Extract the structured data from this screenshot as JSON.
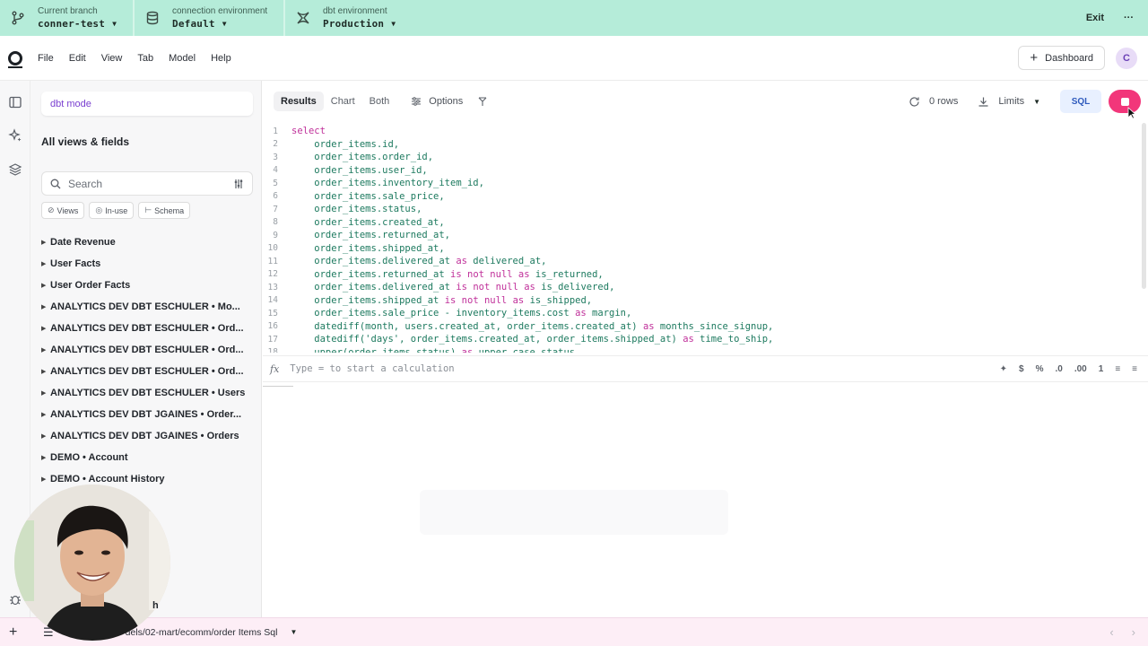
{
  "env_bar": {
    "branch": {
      "caption": "Current branch",
      "value": "conner-test"
    },
    "connection": {
      "caption": "connection environment",
      "value": "Default"
    },
    "dbt_env": {
      "caption": "dbt environment",
      "value": "Production"
    },
    "exit_label": "Exit",
    "more_label": "···"
  },
  "menu": {
    "items": [
      "File",
      "Edit",
      "View",
      "Tab",
      "Model",
      "Help"
    ],
    "dashboard_label": "Dashboard",
    "avatar_initial": "C"
  },
  "sidebar": {
    "mode_label": "dbt mode",
    "title": "All views & fields",
    "search_placeholder": "Search",
    "filters": [
      "Views",
      "In-use",
      "Schema"
    ],
    "items": [
      "Date Revenue",
      "User Facts",
      "User Order Facts",
      "ANALYTICS DEV DBT ESCHULER • Mo...",
      "ANALYTICS DEV DBT ESCHULER • Ord...",
      "ANALYTICS DEV DBT ESCHULER • Ord...",
      "ANALYTICS DEV DBT ESCHULER • Ord...",
      "ANALYTICS DEV DBT ESCHULER • Users",
      "ANALYTICS DEV DBT JGAINES • Order...",
      "ANALYTICS DEV DBT JGAINES • Orders",
      "DEMO • Account",
      "DEMO • Account History"
    ],
    "partial_item": "h"
  },
  "toolbar": {
    "tabs": [
      "Results",
      "Chart",
      "Both"
    ],
    "options_label": "Options",
    "rows_label": "0 rows",
    "limits_label": "Limits",
    "sql_label": "SQL"
  },
  "editor": {
    "lines": [
      {
        "n": "1",
        "kw": "select",
        "rest": ""
      },
      {
        "n": "2",
        "kw": "",
        "rest": "    order_items.id,"
      },
      {
        "n": "3",
        "kw": "",
        "rest": "    order_items.order_id,"
      },
      {
        "n": "4",
        "kw": "",
        "rest": "    order_items.user_id,"
      },
      {
        "n": "5",
        "kw": "",
        "rest": "    order_items.inventory_item_id,"
      },
      {
        "n": "6",
        "kw": "",
        "rest": "    order_items.sale_price,"
      },
      {
        "n": "7",
        "kw": "",
        "rest": "    order_items.status,"
      },
      {
        "n": "8",
        "kw": "",
        "rest": "    order_items.created_at,"
      },
      {
        "n": "9",
        "kw": "",
        "rest": "    order_items.returned_at,"
      },
      {
        "n": "10",
        "kw": "",
        "rest": "    order_items.shipped_at,"
      },
      {
        "n": "11",
        "kw": "",
        "rest": "    order_items.delivered_at as delivered_at,"
      },
      {
        "n": "12",
        "kw": "",
        "rest": "    order_items.returned_at is not null as is_returned,"
      },
      {
        "n": "13",
        "kw": "",
        "rest": "    order_items.delivered_at is not null as is_delivered,"
      },
      {
        "n": "14",
        "kw": "",
        "rest": "    order_items.shipped_at is not null as is_shipped,"
      },
      {
        "n": "15",
        "kw": "",
        "rest": "    order_items.sale_price - inventory_items.cost as margin,"
      },
      {
        "n": "16",
        "kw": "",
        "rest": "    datediff(month, users.created_at, order_items.created_at) as months_since_signup,"
      },
      {
        "n": "17",
        "kw": "",
        "rest": "    datediff('days', order_items.created_at, order_items.shipped_at) as time_to_ship,"
      },
      {
        "n": "18",
        "kw": "",
        "rest": "    upper(order_items.status) as upper_case_status"
      }
    ]
  },
  "calc": {
    "fx_label": "fx",
    "placeholder": "Type = to start a calculation",
    "icons": [
      "✦",
      "$",
      "%",
      ".0",
      ".00",
      "1",
      "≡",
      "≡"
    ]
  },
  "bottom": {
    "path": "dels/02-mart/ecomm/order Items Sql"
  },
  "colors": {
    "env_bar": "#b5ecd9",
    "run_button": "#f2367a",
    "keyword": "#c0309a",
    "code": "#1d7a5f"
  }
}
